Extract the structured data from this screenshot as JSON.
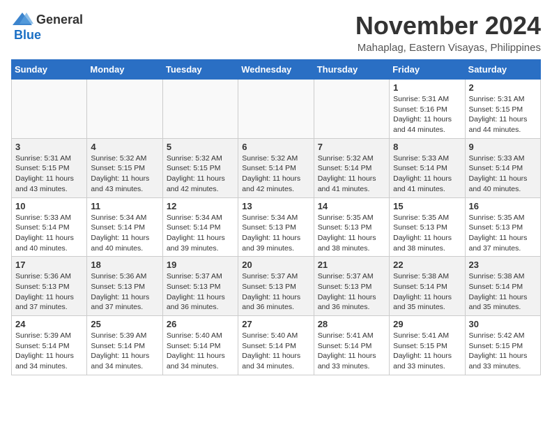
{
  "logo": {
    "general": "General",
    "blue": "Blue"
  },
  "title": "November 2024",
  "location": "Mahaplag, Eastern Visayas, Philippines",
  "days_of_week": [
    "Sunday",
    "Monday",
    "Tuesday",
    "Wednesday",
    "Thursday",
    "Friday",
    "Saturday"
  ],
  "weeks": [
    {
      "alt": false,
      "days": [
        {
          "date": "",
          "empty": true
        },
        {
          "date": "",
          "empty": true
        },
        {
          "date": "",
          "empty": true
        },
        {
          "date": "",
          "empty": true
        },
        {
          "date": "",
          "empty": true
        },
        {
          "date": "1",
          "sunrise": "Sunrise: 5:31 AM",
          "sunset": "Sunset: 5:16 PM",
          "daylight": "Daylight: 11 hours and 44 minutes."
        },
        {
          "date": "2",
          "sunrise": "Sunrise: 5:31 AM",
          "sunset": "Sunset: 5:15 PM",
          "daylight": "Daylight: 11 hours and 44 minutes."
        }
      ]
    },
    {
      "alt": true,
      "days": [
        {
          "date": "3",
          "sunrise": "Sunrise: 5:31 AM",
          "sunset": "Sunset: 5:15 PM",
          "daylight": "Daylight: 11 hours and 43 minutes."
        },
        {
          "date": "4",
          "sunrise": "Sunrise: 5:32 AM",
          "sunset": "Sunset: 5:15 PM",
          "daylight": "Daylight: 11 hours and 43 minutes."
        },
        {
          "date": "5",
          "sunrise": "Sunrise: 5:32 AM",
          "sunset": "Sunset: 5:15 PM",
          "daylight": "Daylight: 11 hours and 42 minutes."
        },
        {
          "date": "6",
          "sunrise": "Sunrise: 5:32 AM",
          "sunset": "Sunset: 5:14 PM",
          "daylight": "Daylight: 11 hours and 42 minutes."
        },
        {
          "date": "7",
          "sunrise": "Sunrise: 5:32 AM",
          "sunset": "Sunset: 5:14 PM",
          "daylight": "Daylight: 11 hours and 41 minutes."
        },
        {
          "date": "8",
          "sunrise": "Sunrise: 5:33 AM",
          "sunset": "Sunset: 5:14 PM",
          "daylight": "Daylight: 11 hours and 41 minutes."
        },
        {
          "date": "9",
          "sunrise": "Sunrise: 5:33 AM",
          "sunset": "Sunset: 5:14 PM",
          "daylight": "Daylight: 11 hours and 40 minutes."
        }
      ]
    },
    {
      "alt": false,
      "days": [
        {
          "date": "10",
          "sunrise": "Sunrise: 5:33 AM",
          "sunset": "Sunset: 5:14 PM",
          "daylight": "Daylight: 11 hours and 40 minutes."
        },
        {
          "date": "11",
          "sunrise": "Sunrise: 5:34 AM",
          "sunset": "Sunset: 5:14 PM",
          "daylight": "Daylight: 11 hours and 40 minutes."
        },
        {
          "date": "12",
          "sunrise": "Sunrise: 5:34 AM",
          "sunset": "Sunset: 5:14 PM",
          "daylight": "Daylight: 11 hours and 39 minutes."
        },
        {
          "date": "13",
          "sunrise": "Sunrise: 5:34 AM",
          "sunset": "Sunset: 5:13 PM",
          "daylight": "Daylight: 11 hours and 39 minutes."
        },
        {
          "date": "14",
          "sunrise": "Sunrise: 5:35 AM",
          "sunset": "Sunset: 5:13 PM",
          "daylight": "Daylight: 11 hours and 38 minutes."
        },
        {
          "date": "15",
          "sunrise": "Sunrise: 5:35 AM",
          "sunset": "Sunset: 5:13 PM",
          "daylight": "Daylight: 11 hours and 38 minutes."
        },
        {
          "date": "16",
          "sunrise": "Sunrise: 5:35 AM",
          "sunset": "Sunset: 5:13 PM",
          "daylight": "Daylight: 11 hours and 37 minutes."
        }
      ]
    },
    {
      "alt": true,
      "days": [
        {
          "date": "17",
          "sunrise": "Sunrise: 5:36 AM",
          "sunset": "Sunset: 5:13 PM",
          "daylight": "Daylight: 11 hours and 37 minutes."
        },
        {
          "date": "18",
          "sunrise": "Sunrise: 5:36 AM",
          "sunset": "Sunset: 5:13 PM",
          "daylight": "Daylight: 11 hours and 37 minutes."
        },
        {
          "date": "19",
          "sunrise": "Sunrise: 5:37 AM",
          "sunset": "Sunset: 5:13 PM",
          "daylight": "Daylight: 11 hours and 36 minutes."
        },
        {
          "date": "20",
          "sunrise": "Sunrise: 5:37 AM",
          "sunset": "Sunset: 5:13 PM",
          "daylight": "Daylight: 11 hours and 36 minutes."
        },
        {
          "date": "21",
          "sunrise": "Sunrise: 5:37 AM",
          "sunset": "Sunset: 5:13 PM",
          "daylight": "Daylight: 11 hours and 36 minutes."
        },
        {
          "date": "22",
          "sunrise": "Sunrise: 5:38 AM",
          "sunset": "Sunset: 5:14 PM",
          "daylight": "Daylight: 11 hours and 35 minutes."
        },
        {
          "date": "23",
          "sunrise": "Sunrise: 5:38 AM",
          "sunset": "Sunset: 5:14 PM",
          "daylight": "Daylight: 11 hours and 35 minutes."
        }
      ]
    },
    {
      "alt": false,
      "days": [
        {
          "date": "24",
          "sunrise": "Sunrise: 5:39 AM",
          "sunset": "Sunset: 5:14 PM",
          "daylight": "Daylight: 11 hours and 34 minutes."
        },
        {
          "date": "25",
          "sunrise": "Sunrise: 5:39 AM",
          "sunset": "Sunset: 5:14 PM",
          "daylight": "Daylight: 11 hours and 34 minutes."
        },
        {
          "date": "26",
          "sunrise": "Sunrise: 5:40 AM",
          "sunset": "Sunset: 5:14 PM",
          "daylight": "Daylight: 11 hours and 34 minutes."
        },
        {
          "date": "27",
          "sunrise": "Sunrise: 5:40 AM",
          "sunset": "Sunset: 5:14 PM",
          "daylight": "Daylight: 11 hours and 34 minutes."
        },
        {
          "date": "28",
          "sunrise": "Sunrise: 5:41 AM",
          "sunset": "Sunset: 5:14 PM",
          "daylight": "Daylight: 11 hours and 33 minutes."
        },
        {
          "date": "29",
          "sunrise": "Sunrise: 5:41 AM",
          "sunset": "Sunset: 5:15 PM",
          "daylight": "Daylight: 11 hours and 33 minutes."
        },
        {
          "date": "30",
          "sunrise": "Sunrise: 5:42 AM",
          "sunset": "Sunset: 5:15 PM",
          "daylight": "Daylight: 11 hours and 33 minutes."
        }
      ]
    }
  ]
}
